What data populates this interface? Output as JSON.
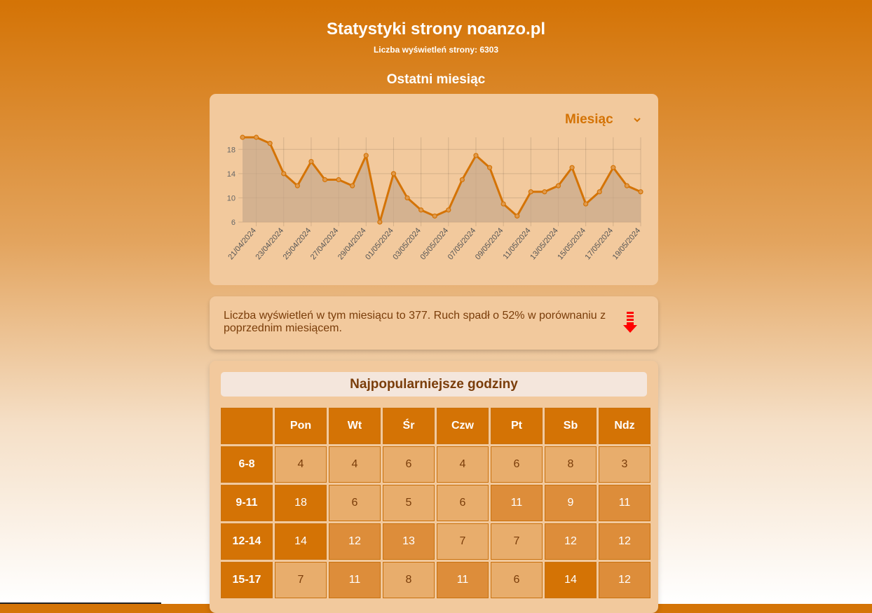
{
  "header": {
    "title": "Statystyki strony noanzo.pl",
    "total_views": "Liczba wyświetleń strony: 6303",
    "section_title": "Ostatni miesiąc"
  },
  "period_select": {
    "selected": "Miesiąc",
    "icon": "chevron-down-icon"
  },
  "chart_data": {
    "type": "area",
    "x": [
      "20/04/2024",
      "21/04/2024",
      "22/04/2024",
      "23/04/2024",
      "24/04/2024",
      "25/04/2024",
      "26/04/2024",
      "27/04/2024",
      "28/04/2024",
      "29/04/2024",
      "30/04/2024",
      "01/05/2024",
      "02/05/2024",
      "03/05/2024",
      "04/05/2024",
      "05/05/2024",
      "06/05/2024",
      "07/05/2024",
      "08/05/2024",
      "09/05/2024",
      "10/05/2024",
      "11/05/2024",
      "12/05/2024",
      "13/05/2024",
      "14/05/2024",
      "15/05/2024",
      "16/05/2024",
      "17/05/2024",
      "18/05/2024",
      "19/05/2024"
    ],
    "xtick_labels": [
      "21/04/2024",
      "23/04/2024",
      "25/04/2024",
      "27/04/2024",
      "29/04/2024",
      "01/05/2024",
      "03/05/2024",
      "05/05/2024",
      "07/05/2024",
      "09/05/2024",
      "11/05/2024",
      "13/05/2024",
      "15/05/2024",
      "17/05/2024",
      "19/05/2024"
    ],
    "series": [
      {
        "values": [
          20,
          20,
          19,
          14,
          12,
          16,
          13,
          13,
          12,
          17,
          6,
          14,
          10,
          8,
          7,
          8,
          13,
          17,
          15,
          9,
          7,
          11,
          11,
          12,
          15,
          9,
          11,
          15,
          12,
          11
        ]
      }
    ],
    "ylim": [
      6,
      20
    ],
    "yticks": [
      6,
      10,
      14,
      18
    ],
    "grid": true,
    "colors": {
      "line": "#d47305",
      "fill": "#c7a88a"
    }
  },
  "summary": {
    "text": "Liczba wyświetleń w tym miesiącu to 377. Ruch spadł o 52% w porównaniu z poprzednim miesiącem.",
    "trend_icon": "arrow-down-icon",
    "trend_color": "#ff0000"
  },
  "hours": {
    "title": "Najpopularniejsze godziny",
    "days": [
      "Pon",
      "Wt",
      "Śr",
      "Czw",
      "Pt",
      "Sb",
      "Ndz"
    ],
    "rows": [
      {
        "label": "6-8",
        "values": [
          4,
          4,
          6,
          4,
          6,
          8,
          3
        ]
      },
      {
        "label": "9-11",
        "values": [
          18,
          6,
          5,
          6,
          11,
          9,
          11
        ]
      },
      {
        "label": "12-14",
        "values": [
          14,
          12,
          13,
          7,
          7,
          12,
          12
        ]
      },
      {
        "label": "15-17",
        "values": [
          7,
          11,
          8,
          11,
          6,
          14,
          12
        ]
      }
    ]
  }
}
